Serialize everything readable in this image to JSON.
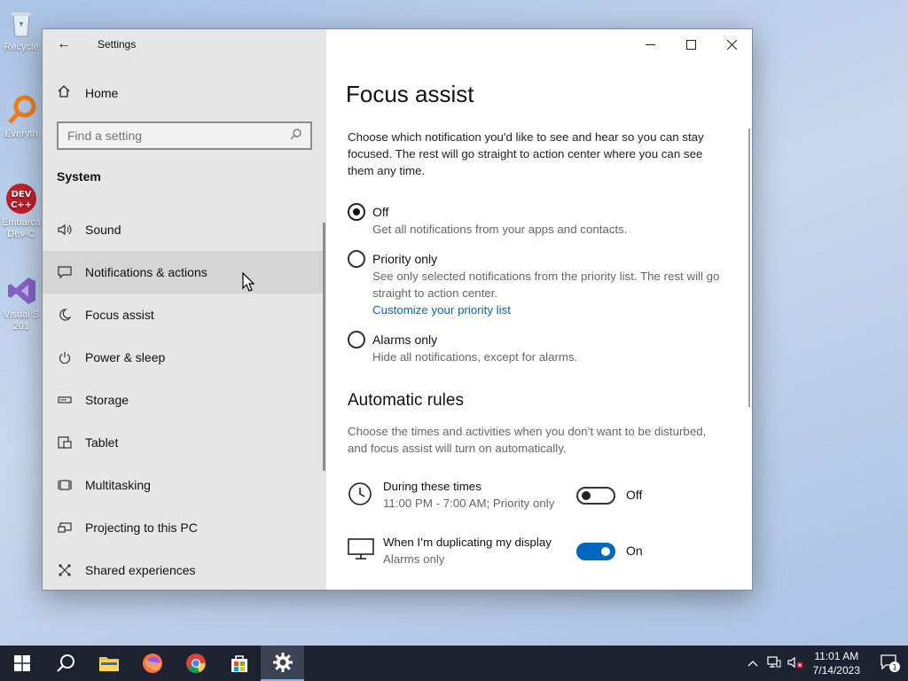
{
  "desktop": {
    "icons": [
      {
        "label": "Recycle",
        "name": "recycle-bin"
      },
      {
        "label": "Everyth",
        "name": "everything"
      },
      {
        "label": "Embarca Dev-C",
        "name": "dev-cpp"
      },
      {
        "label": "Visual S 201",
        "name": "visual-studio"
      }
    ]
  },
  "window": {
    "title": "Settings",
    "back_glyph": "←",
    "controls": {
      "minimize": "—",
      "maximize": "☐",
      "close": "✕"
    }
  },
  "sidebar": {
    "home_label": "Home",
    "search_placeholder": "Find a setting",
    "section_label": "System",
    "items": [
      {
        "label": "Sound",
        "icon": "speaker-icon"
      },
      {
        "label": "Notifications & actions",
        "icon": "message-icon"
      },
      {
        "label": "Focus assist",
        "icon": "moon-icon"
      },
      {
        "label": "Power & sleep",
        "icon": "power-icon"
      },
      {
        "label": "Storage",
        "icon": "storage-icon"
      },
      {
        "label": "Tablet",
        "icon": "tablet-icon"
      },
      {
        "label": "Multitasking",
        "icon": "multitasking-icon"
      },
      {
        "label": "Projecting to this PC",
        "icon": "projector-icon"
      },
      {
        "label": "Shared experiences",
        "icon": "share-icon"
      }
    ]
  },
  "content": {
    "title": "Focus assist",
    "description": "Choose which notification you'd like to see and hear so you can stay focused. The rest will go straight to action center where you can see them any time.",
    "options": [
      {
        "label": "Off",
        "sub": "Get all notifications from your apps and contacts.",
        "checked": true
      },
      {
        "label": "Priority only",
        "sub": "See only selected notifications from the priority list. The rest will go straight to action center.",
        "link": "Customize your priority list",
        "checked": false
      },
      {
        "label": "Alarms only",
        "sub": "Hide all notifications, except for alarms.",
        "checked": false
      }
    ],
    "auto_rules_title": "Automatic rules",
    "auto_rules_desc": "Choose the times and activities when you don’t want to be disturbed, and focus assist will turn on automatically.",
    "rules": [
      {
        "title": "During these times",
        "sub": "11:00 PM - 7:00 AM; Priority only",
        "state": "Off",
        "on": false,
        "icon": "clock-icon"
      },
      {
        "title": "When I’m duplicating my display",
        "sub": "Alarms only",
        "state": "On",
        "on": true,
        "icon": "monitor-icon"
      }
    ]
  },
  "taskbar": {
    "apps": [
      "start",
      "search",
      "file-explorer",
      "firefox",
      "chrome",
      "microsoft-store",
      "settings"
    ],
    "active": "settings",
    "time": "11:01 AM",
    "date": "7/14/2023",
    "notification_count": "1"
  },
  "colors": {
    "accent": "#0067c0",
    "taskbar": "#1c2230",
    "sidebar_bg": "#e6e6e6",
    "hover_bg": "#d5d5d5"
  }
}
